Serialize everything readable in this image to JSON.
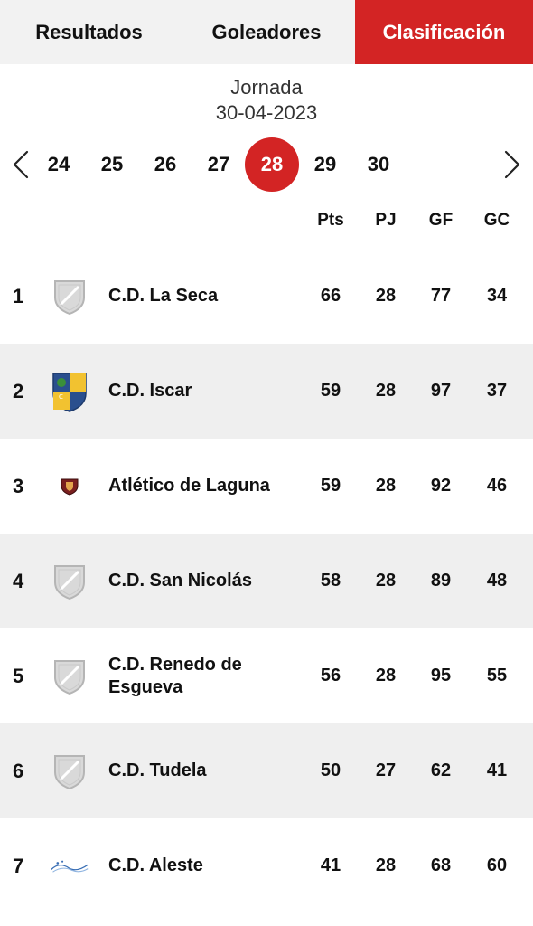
{
  "tabs": [
    {
      "label": "Resultados",
      "active": false
    },
    {
      "label": "Goleadores",
      "active": false
    },
    {
      "label": "Clasificación",
      "active": true
    }
  ],
  "jornada": {
    "label": "Jornada",
    "date": "30-04-2023"
  },
  "rounds": [
    "24",
    "25",
    "26",
    "27",
    "28",
    "29",
    "30"
  ],
  "active_round": "28",
  "columns": {
    "pts": "Pts",
    "pj": "PJ",
    "gf": "GF",
    "gc": "GC"
  },
  "standings": [
    {
      "pos": "1",
      "team": "C.D. La Seca",
      "pts": "66",
      "pj": "28",
      "gf": "77",
      "gc": "34",
      "logo": "default-shield-icon"
    },
    {
      "pos": "2",
      "team": "C.D. Iscar",
      "pts": "59",
      "pj": "28",
      "gf": "97",
      "gc": "37",
      "logo": "iscar-crest-icon"
    },
    {
      "pos": "3",
      "team": "Atlético de Laguna",
      "pts": "59",
      "pj": "28",
      "gf": "92",
      "gc": "46",
      "logo": "laguna-crest-icon"
    },
    {
      "pos": "4",
      "team": "C.D. San Nicolás",
      "pts": "58",
      "pj": "28",
      "gf": "89",
      "gc": "48",
      "logo": "default-shield-icon"
    },
    {
      "pos": "5",
      "team": "C.D. Renedo de Esgueva",
      "pts": "56",
      "pj": "28",
      "gf": "95",
      "gc": "55",
      "logo": "default-shield-icon"
    },
    {
      "pos": "6",
      "team": "C.D. Tudela",
      "pts": "50",
      "pj": "27",
      "gf": "62",
      "gc": "41",
      "logo": "default-shield-icon"
    },
    {
      "pos": "7",
      "team": "C.D. Aleste",
      "pts": "41",
      "pj": "28",
      "gf": "68",
      "gc": "60",
      "logo": "aleste-logo-icon"
    }
  ],
  "colors": {
    "accent": "#d32424",
    "tab_bg": "#f2f2f2",
    "row_alt": "#efefef"
  }
}
